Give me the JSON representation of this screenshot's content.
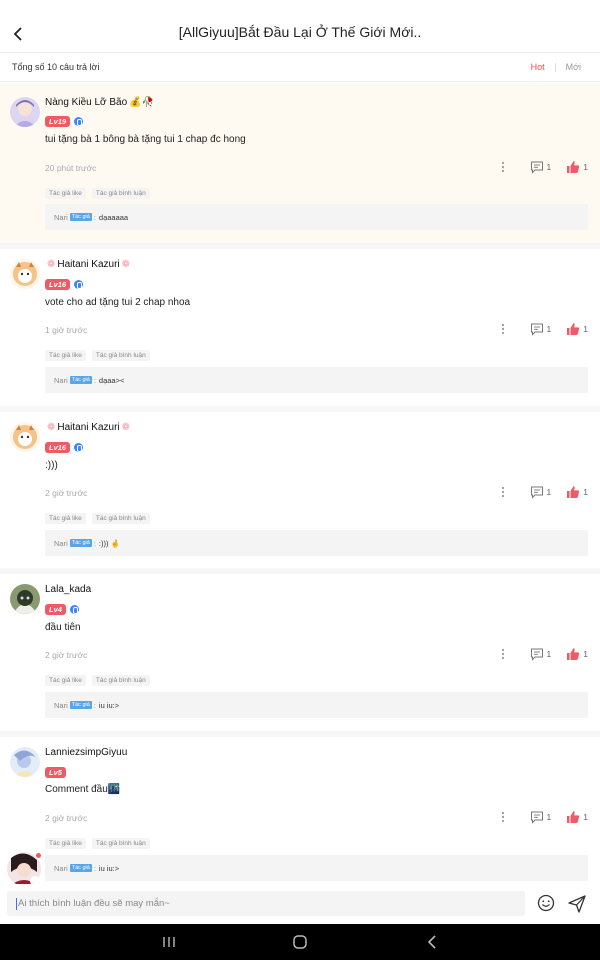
{
  "header": {
    "title": "[AllGiyuu]Bắt Đầu Lại Ở Thế Giới Mới.."
  },
  "subbar": {
    "total": "Tổng số 10 câu trả lời",
    "sort_hot": "Hot",
    "sort_new": "Mới"
  },
  "tags": {
    "author_like": "Tác giả like",
    "author_comment": "Tác giả bình luận",
    "author_badge": "Tác giả"
  },
  "comments": [
    {
      "username": "Nàng Kiều Lỡ Bão",
      "username_emoji": "💰🥀",
      "level": "Lv19",
      "text": "tui tặng bà 1 bông bà tặng tui 1 chap đc hong",
      "time": "20 phút trước",
      "replies": "1",
      "likes": "1",
      "reply_author": "Nari",
      "reply_text": "dạaaaaa"
    },
    {
      "username": "Haitani Kazuri",
      "level": "Lv16",
      "text": "vote cho ad tặng tui 2 chap nhoa",
      "time": "1 giờ trước",
      "replies": "1",
      "likes": "1",
      "reply_author": "Nari",
      "reply_text": "dạaa><"
    },
    {
      "username": "Haitani Kazuri",
      "level": "Lv16",
      "text": ":)))",
      "time": "2 giờ trước",
      "replies": "1",
      "likes": "1",
      "reply_author": "Nari",
      "reply_text": ":))) 🤞"
    },
    {
      "username": "Lala_kada",
      "level": "Lv4",
      "text": "đầu tiên",
      "time": "2 giờ trước",
      "replies": "1",
      "likes": "1",
      "reply_author": "Nari",
      "reply_text": "iu iu:>"
    },
    {
      "username": "LanniezsimpGiyuu",
      "level": "Lv5",
      "text": "Comment đầu🌃",
      "time": "2 giờ trước",
      "replies": "1",
      "likes": "1",
      "reply_author": "Nari",
      "reply_text": "iu iu:>"
    }
  ],
  "input": {
    "placeholder": "Ai thích bình luận đều sẽ may mắn~"
  },
  "colors": {
    "accent": "#f04a54",
    "level_badge": "#f05a67",
    "like": "#f05a67",
    "highlight_bg": "#fffaf1",
    "verify": "#3d86f2"
  },
  "icons": [
    "back-arrow-icon",
    "verified-icon",
    "more-vert-icon",
    "comment-icon",
    "thumbs-up-icon",
    "emoji-icon",
    "send-icon",
    "nav-recents-icon",
    "nav-home-icon",
    "nav-back-icon"
  ]
}
